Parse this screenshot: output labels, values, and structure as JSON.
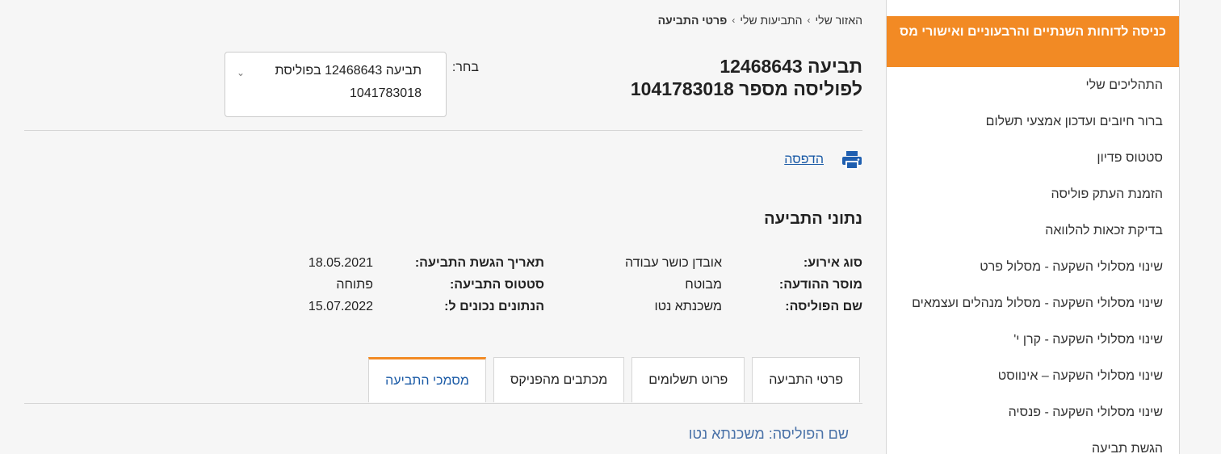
{
  "sidebar": {
    "header": "כניסה לדוחות השנתיים והרבעוניים ואישורי מס",
    "items": [
      "התהליכים שלי",
      "ברור חיובים ועדכון אמצעי תשלום",
      "סטטוס פדיון",
      "הזמנת העתק פוליסה",
      "בדיקת זכאות להלוואה",
      "שינוי מסלולי השקעה - מסלול פרט",
      "שינוי מסלולי השקעה - מסלול מנהלים ועצמאים",
      "שינוי מסלולי השקעה - קרן י'",
      "שינוי מסלולי השקעה – אינווסט",
      "שינוי מסלולי השקעה - פנסיה",
      "הגשת תביעה"
    ]
  },
  "breadcrumb": {
    "home": "האזור שלי",
    "claims": "התביעות שלי",
    "current": "פרטי התביעה",
    "separator": "›"
  },
  "header": {
    "title_line1": "תביעה 12468643",
    "title_line2": "לפוליסה מספר 1041783018",
    "select_label": "בחר:",
    "select_value_line1": "תביעה 12468643 בפוליסת",
    "select_value_line2": "1041783018"
  },
  "actions": {
    "print_label": "הדפסה",
    "print_icon": "printer-icon"
  },
  "claim_data": {
    "title": "נתוני התביעה",
    "event_type_label": "סוג אירוע:",
    "event_type_value": "אובדן כושר עבודה",
    "reporter_label": "מוסר ההודעה:",
    "reporter_value": "מבוטח",
    "policy_name_label": "שם הפוליסה:",
    "policy_name_value": "משכנתא נטו",
    "submit_date_label": "תאריך הגשת התביעה:",
    "submit_date_value": "18.05.2021",
    "status_label": "סטטוס התביעה:",
    "status_value": "פתוחה",
    "as_of_label": "הנתונים נכונים ל:",
    "as_of_value": "15.07.2022"
  },
  "tabs": [
    {
      "label": "פרטי התביעה",
      "active": false
    },
    {
      "label": "פרוט תשלומים",
      "active": false
    },
    {
      "label": "מכתבים מהפניקס",
      "active": false
    },
    {
      "label": "מסמכי התביעה",
      "active": true
    }
  ],
  "policy_name_line": "שם הפוליסה: משכנתא נטו",
  "colors": {
    "accent": "#f28a24",
    "link": "#1a5aa6",
    "print_icon": "#1f5fb0"
  }
}
